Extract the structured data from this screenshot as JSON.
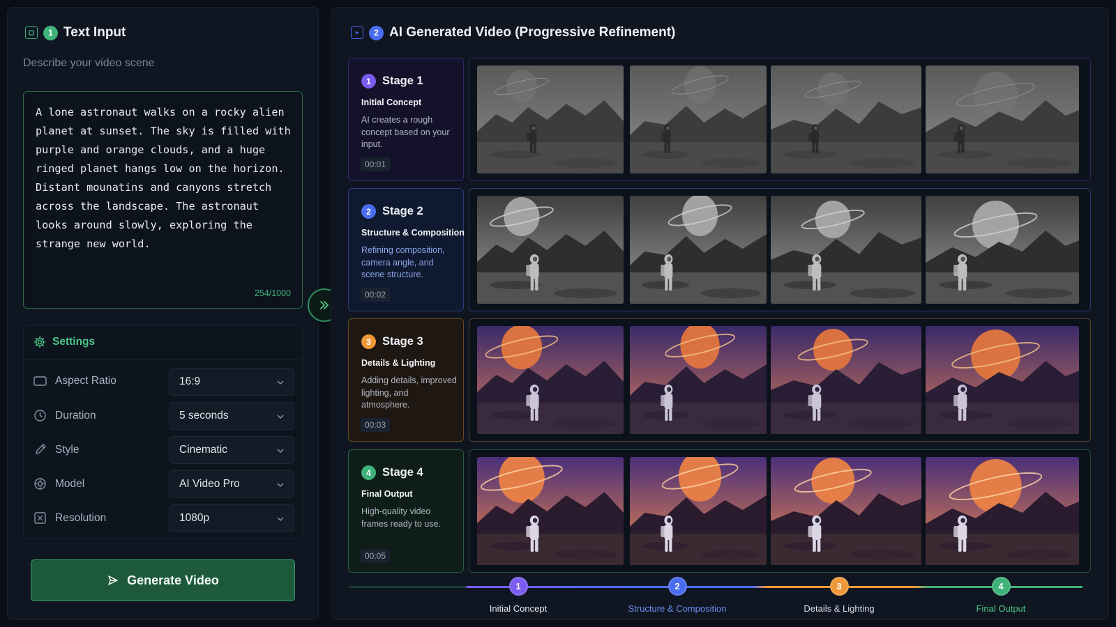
{
  "left_panel": {
    "title": "Text Input",
    "step_number": "1",
    "subtitle": "Describe your video scene",
    "prompt_text": "A lone astronaut walks on a rocky alien\nplanet at sunset. The sky is filled with\npurple and orange clouds, and a huge\nringed planet hangs low on the horizon.\nDistant mounatins and canyons stretch\nacross the landscape. The astronaut\nlooks around slowly, exploring the\nstrange new world.",
    "char_count": "254/1000"
  },
  "settings": {
    "title": "Settings",
    "rows": [
      {
        "label": "Aspect Ratio",
        "value": "16:9",
        "icon": "aspect-ratio-icon"
      },
      {
        "label": "Duration",
        "value": "5 seconds",
        "icon": "clock-icon"
      },
      {
        "label": "Style",
        "value": "Cinematic",
        "icon": "brush-icon"
      },
      {
        "label": "Model",
        "value": "AI Video Pro",
        "icon": "model-icon"
      },
      {
        "label": "Resolution",
        "value": "1080p",
        "icon": "resolution-icon"
      }
    ]
  },
  "generate_button": {
    "label": "Generate Video",
    "icon": "send-icon"
  },
  "right_panel": {
    "title": "AI Generated Video (Progressive Refinement)",
    "step_number": "2"
  },
  "stages": [
    {
      "number": "1",
      "title": "Stage 1",
      "name": "Initial Concept",
      "desc": "AI creates a rough concept based on your input.",
      "time": "00:01",
      "accent": "#7b5cf0"
    },
    {
      "number": "2",
      "title": "Stage 2",
      "name": "Structure & Composition",
      "desc": "Refining composition, camera angle, and scene structure.",
      "time": "00:02",
      "accent": "#4a6cf0"
    },
    {
      "number": "3",
      "title": "Stage 3",
      "name": "Details & Lighting",
      "desc": "Adding details, improved lighting, and atmosphere.",
      "time": "00:03",
      "accent": "#f0993a"
    },
    {
      "number": "4",
      "title": "Stage 4",
      "name": "Final Output",
      "desc": "High-quality video frames ready to use.",
      "time": "00:05",
      "accent": "#3fb27a"
    }
  ],
  "timeline": [
    {
      "number": "1",
      "label": "Initial Concept",
      "color": "#7b5cf0",
      "text_color": "#e6ebf2"
    },
    {
      "number": "2",
      "label": "Structure & Composition",
      "color": "#4a6cf0",
      "text_color": "#6d8cf5"
    },
    {
      "number": "3",
      "label": "Details & Lighting",
      "color": "#f0993a",
      "text_color": "#d9dee6"
    },
    {
      "number": "4",
      "label": "Final Output",
      "color": "#3fb27a",
      "text_color": "#4cc585"
    }
  ],
  "colors": {
    "green_accent": "#3fb27a",
    "purple": "#7b5cf0",
    "blue": "#4a6cf0",
    "orange": "#f0993a"
  }
}
